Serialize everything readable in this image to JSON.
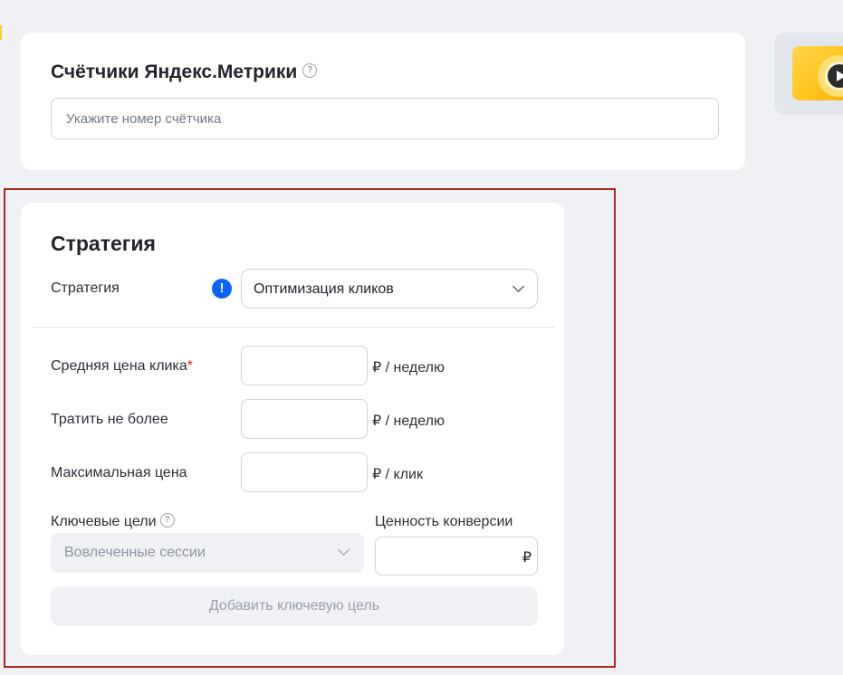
{
  "colors": {
    "background": "#eff1f5",
    "card": "#ffffff",
    "highlight_frame": "#b0261c",
    "warning_icon": "#0b63f6",
    "required_mark": "#e0291b",
    "disabled_text": "#9aa0ab"
  },
  "metrika": {
    "title": "Счётчики Яндекс.Метрики",
    "help_icon": "?",
    "counter_placeholder": "Укажите номер счётчика",
    "counter_value": ""
  },
  "promo": {
    "icon": "play-icon"
  },
  "strategy": {
    "title": "Стратегия",
    "strategy_label": "Стратегия",
    "warning_icon": "!",
    "selected_strategy": "Оптимизация кликов",
    "fields": {
      "avg_click": {
        "label": "Средняя цена клика",
        "required_mark": "*",
        "value": "",
        "unit": "₽ / неделю"
      },
      "spend_limit": {
        "label": "Тратить не более",
        "value": "",
        "unit": "₽ / неделю"
      },
      "max_price": {
        "label": "Максимальная цена",
        "value": "",
        "unit": "₽ / клик"
      }
    },
    "key_goals": {
      "label": "Ключевые цели",
      "help_icon": "?",
      "selected_goal": "Вовлеченные сессии"
    },
    "conversion_value": {
      "label": "Ценность конверсии",
      "value": "",
      "currency": "₽"
    },
    "add_goal_button": "Добавить ключевую цель"
  }
}
